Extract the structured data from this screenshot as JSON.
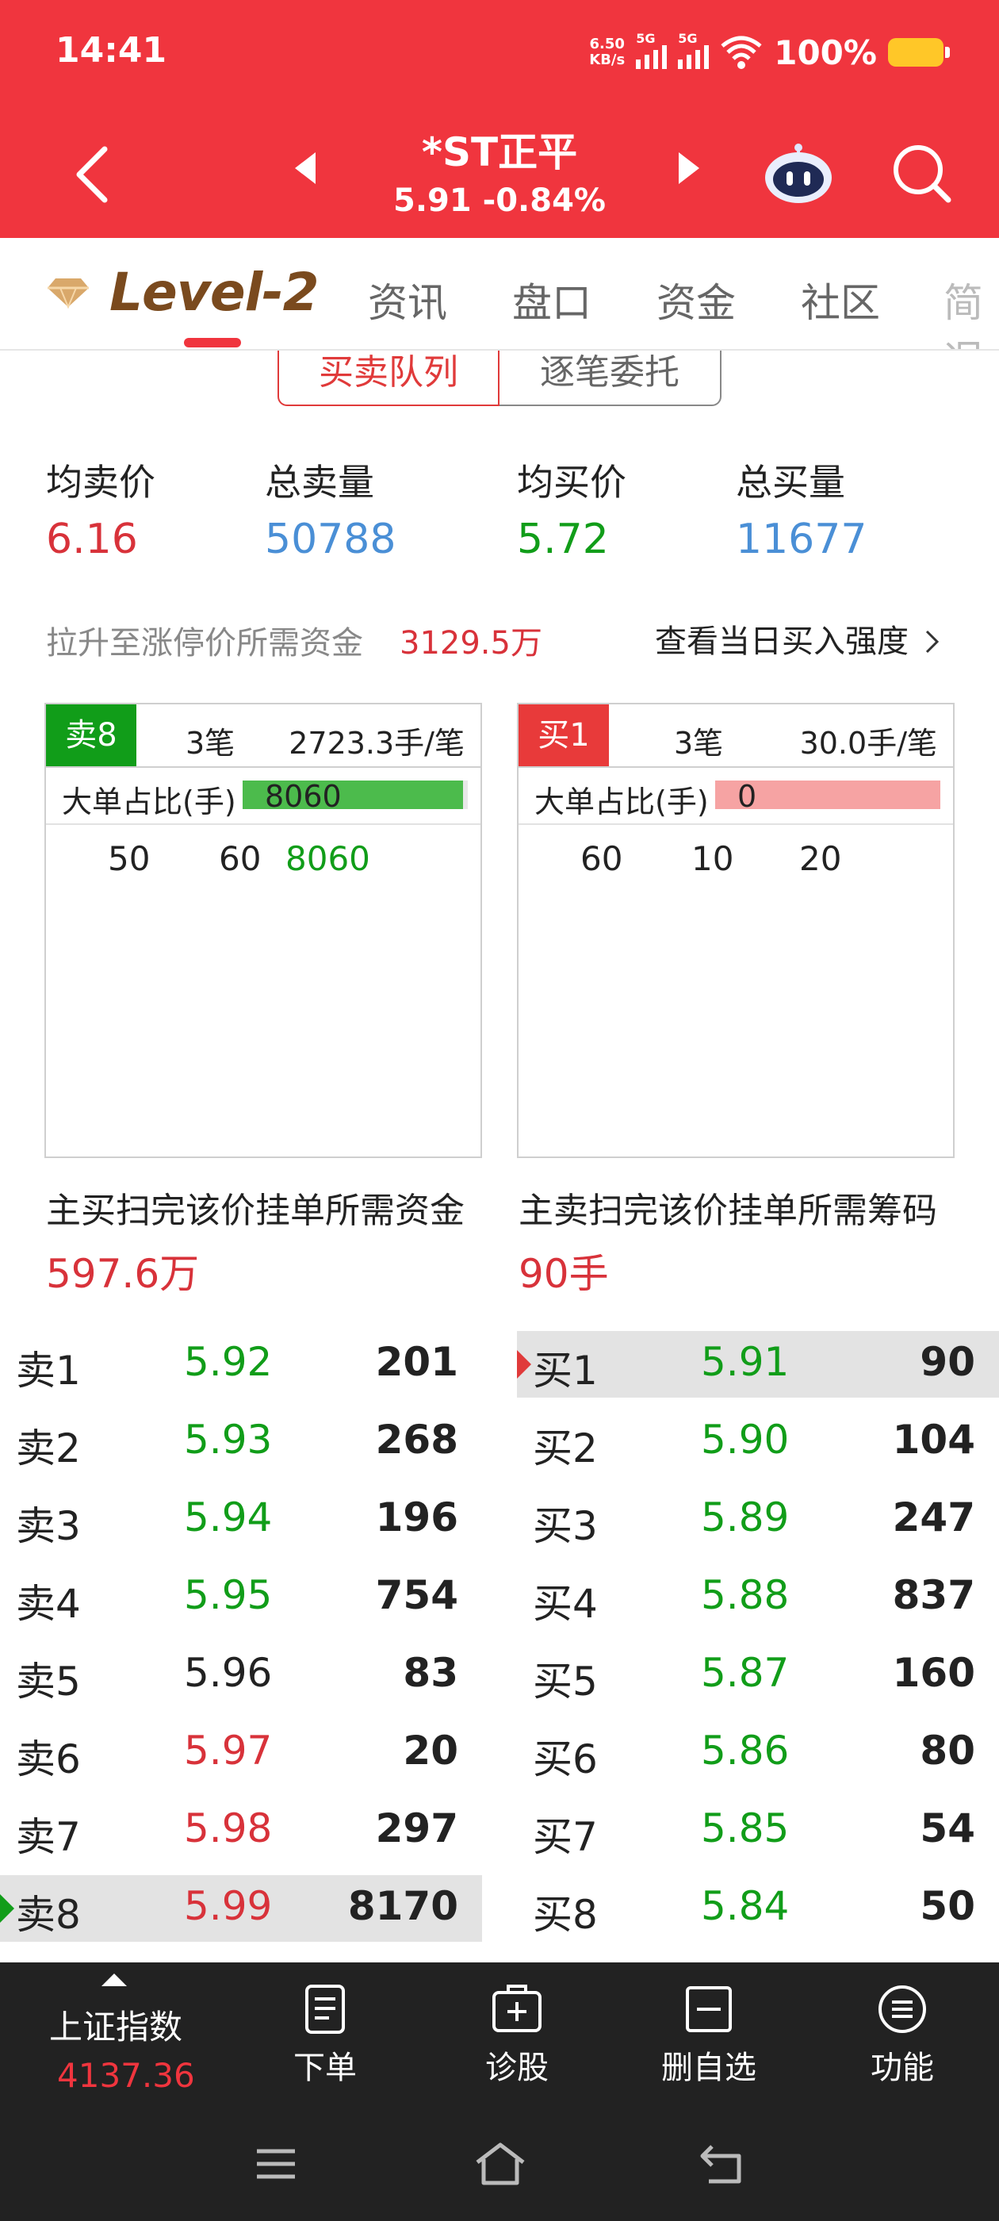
{
  "status_bar": {
    "time": "14:41",
    "net_speed_value": "6.50",
    "net_speed_unit": "KB/s",
    "signal1_label": "5G",
    "signal2_label": "5G",
    "battery_percent": "100%",
    "battery_color": "#ffc728"
  },
  "header": {
    "stock_name": "*ST正平",
    "stock_quote": "5.91 -0.84%",
    "background_color": "#f0353e"
  },
  "tabs": {
    "level2_label": "Level-2",
    "items": [
      "资讯",
      "盘口",
      "资金",
      "社区",
      "简况"
    ]
  },
  "subtabs": {
    "items": [
      "买卖队列",
      "逐笔委托"
    ],
    "active": "买卖队列"
  },
  "summary": {
    "avg_sell_label": "均卖价",
    "avg_sell_value": "6.16",
    "total_sell_label": "总卖量",
    "total_sell_value": "50788",
    "avg_buy_label": "均买价",
    "avg_buy_value": "5.72",
    "total_buy_label": "总买量",
    "total_buy_value": "11677",
    "limit_up_label": "拉升至涨停价所需资金",
    "limit_up_value": "3129.5万",
    "buy_strength_link": "查看当日买入强度"
  },
  "sell_queue": {
    "tag": "卖8",
    "count": "3笔",
    "avg_per_order": "2723.3手/笔",
    "big_order_label": "大单占比(手)",
    "big_order_value": "8060",
    "big_order_fraction": 0.98,
    "orders": [
      "50",
      "60",
      "8060"
    ],
    "sweep_label": "主买扫完该价挂单所需资金",
    "sweep_value": "597.6万"
  },
  "buy_queue": {
    "tag": "买1",
    "count": "3笔",
    "avg_per_order": "30.0手/笔",
    "big_order_label": "大单占比(手)",
    "big_order_value": "0",
    "big_order_fraction": 1.0,
    "orders": [
      "60",
      "10",
      "20"
    ],
    "sweep_label": "主卖扫完该价挂单所需筹码",
    "sweep_value": "90手"
  },
  "sell_book": [
    {
      "label": "卖1",
      "price": "5.92",
      "volume": "201",
      "color": "green"
    },
    {
      "label": "卖2",
      "price": "5.93",
      "volume": "268",
      "color": "green"
    },
    {
      "label": "卖3",
      "price": "5.94",
      "volume": "196",
      "color": "green"
    },
    {
      "label": "卖4",
      "price": "5.95",
      "volume": "754",
      "color": "green"
    },
    {
      "label": "卖5",
      "price": "5.96",
      "volume": "83",
      "color": "black"
    },
    {
      "label": "卖6",
      "price": "5.97",
      "volume": "20",
      "color": "red"
    },
    {
      "label": "卖7",
      "price": "5.98",
      "volume": "297",
      "color": "red"
    },
    {
      "label": "卖8",
      "price": "5.99",
      "volume": "8170",
      "color": "red"
    }
  ],
  "buy_book": [
    {
      "label": "买1",
      "price": "5.91",
      "volume": "90",
      "color": "green"
    },
    {
      "label": "买2",
      "price": "5.90",
      "volume": "104",
      "color": "green"
    },
    {
      "label": "买3",
      "price": "5.89",
      "volume": "247",
      "color": "green"
    },
    {
      "label": "买4",
      "price": "5.88",
      "volume": "837",
      "color": "green"
    },
    {
      "label": "买5",
      "price": "5.87",
      "volume": "160",
      "color": "green"
    },
    {
      "label": "买6",
      "price": "5.86",
      "volume": "80",
      "color": "green"
    },
    {
      "label": "买7",
      "price": "5.85",
      "volume": "54",
      "color": "green"
    },
    {
      "label": "买8",
      "price": "5.84",
      "volume": "50",
      "color": "green"
    }
  ],
  "toolbar": {
    "index_name": "上证指数",
    "index_value": "4137.36",
    "order_label": "下单",
    "diagnose_label": "诊股",
    "remove_watch_label": "删自选",
    "functions_label": "功能"
  }
}
